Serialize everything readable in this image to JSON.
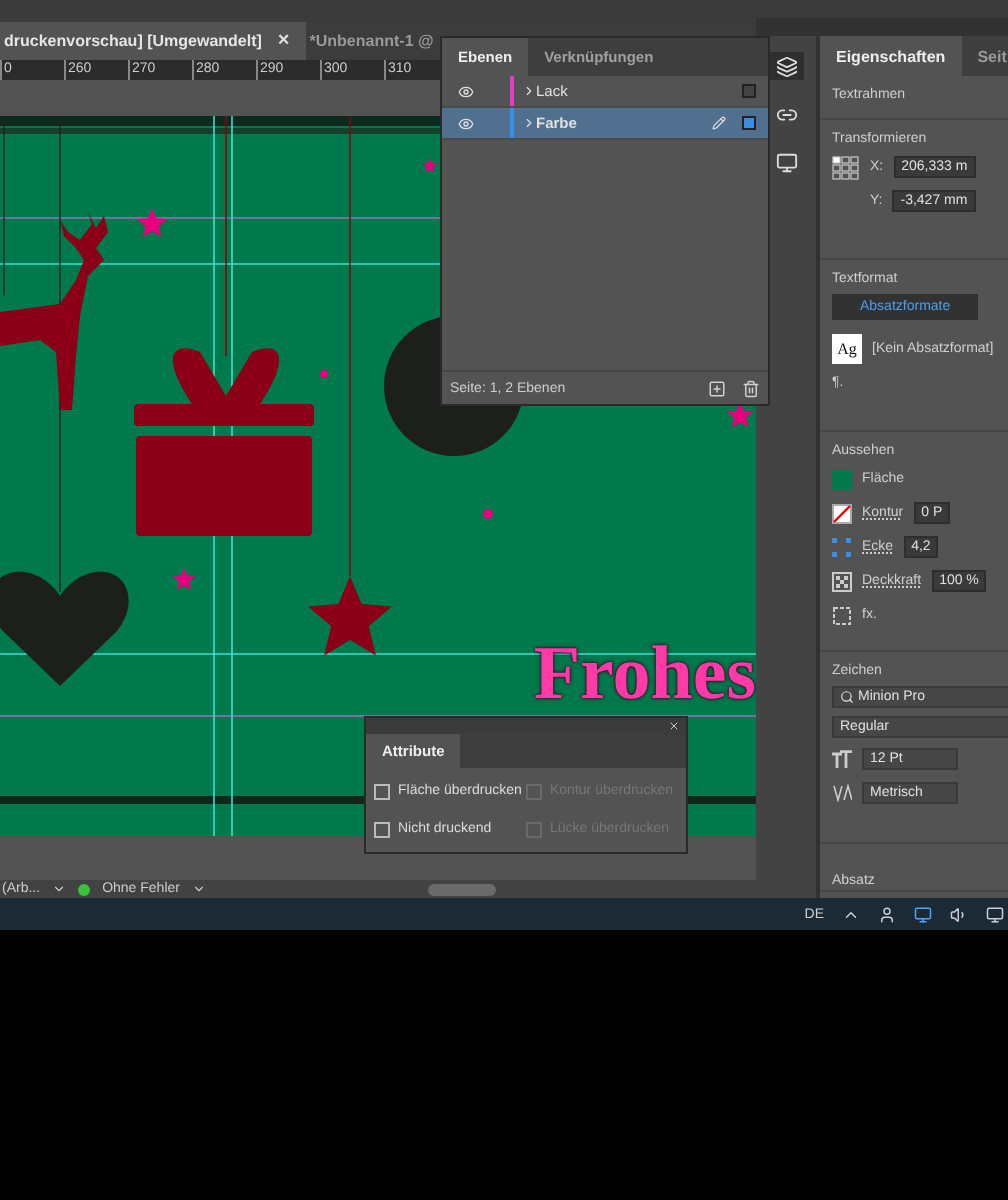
{
  "document_tabs": [
    {
      "label": "druckenvorschau] [Umgewandelt]",
      "selected": true,
      "close": "×"
    },
    {
      "label": "*Unbenannt-1 @",
      "selected": false
    }
  ],
  "ruler": {
    "ticks": [
      "0",
      "260",
      "270",
      "280",
      "290",
      "300",
      "310"
    ]
  },
  "canvas": {
    "headline": "Frohes"
  },
  "layers_panel": {
    "tabs": [
      {
        "label": "Ebenen",
        "selected": true
      },
      {
        "label": "Verknüpfungen",
        "selected": false
      }
    ],
    "layers": [
      {
        "name": "Lack",
        "color": "#e040c8",
        "selected": false
      },
      {
        "name": "Farbe",
        "color": "#3a8ee6",
        "selected": true
      }
    ],
    "footer": "Seite: 1, 2 Ebenen"
  },
  "properties": {
    "tabs": [
      {
        "label": "Eigenschaften",
        "selected": true
      },
      {
        "label": "Seit",
        "selected": false
      }
    ],
    "frame_type": "Textrahmen",
    "transform": {
      "title": "Transformieren",
      "x_label": "X:",
      "x": "206,333 m",
      "y_label": "Y:",
      "y": "-3,427 mm"
    },
    "text_format": {
      "title": "Textformat",
      "button": "Absatzformate",
      "preview": "Ag",
      "style": "[Kein Absatzformat]",
      "pilcrow": "¶."
    },
    "appearance": {
      "title": "Aussehen",
      "fill": "Fläche",
      "stroke": "Kontur",
      "stroke_value": "0 P",
      "corner": "Ecke",
      "corner_value": "4,2",
      "opacity": "Deckkraft",
      "opacity_value": "100 %",
      "effects": "fx."
    },
    "character": {
      "title": "Zeichen",
      "font": "Minion Pro",
      "style": "Regular",
      "size": "12 Pt",
      "kerning": "Metrisch"
    },
    "paragraph": {
      "title": "Absatz"
    }
  },
  "attributes_panel": {
    "title": "Attribute",
    "options": [
      {
        "label": "Fläche überdrucken",
        "checked": false,
        "disabled": false
      },
      {
        "label": "Kontur überdrucken",
        "checked": false,
        "disabled": true
      },
      {
        "label": "Nicht druckend",
        "checked": false,
        "disabled": false
      },
      {
        "label": "Lücke überdrucken",
        "checked": false,
        "disabled": true
      }
    ]
  },
  "status_bar": {
    "workspace": "(Arb...",
    "preflight": "Ohne Fehler"
  },
  "taskbar": {
    "language": "DE"
  }
}
